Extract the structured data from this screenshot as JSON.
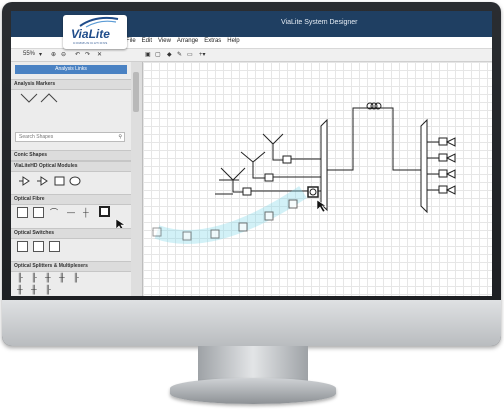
{
  "app": {
    "title": "ViaLite System Designer",
    "logo_text": "ViaLite",
    "logo_sub": "COMMUNICATIONS"
  },
  "menu": [
    "File",
    "Edit",
    "View",
    "Arrange",
    "Extras",
    "Help"
  ],
  "toolbar": {
    "zoom": "55%",
    "icons": [
      "zoom-in-icon",
      "zoom-out-icon",
      "undo-icon",
      "redo-icon",
      "delete-icon",
      "to-front-icon",
      "to-back-icon",
      "fill-icon",
      "line-icon",
      "shadow-icon",
      "insert-icon"
    ]
  },
  "sidebar": {
    "tab_label": "Analysis Links",
    "sections": [
      "Analysis Markers",
      "Conic Shapes",
      "ViaLiteHD Optical Modules",
      "Optical Fibre",
      "Optical Switches",
      "Optical Splitters & Multiplexers"
    ],
    "search_placeholder": "Search Shapes"
  },
  "colors": {
    "titlebar": "#1f3f62",
    "accent": "#4a82c3",
    "fibre_glow": "#7fd8e8"
  }
}
